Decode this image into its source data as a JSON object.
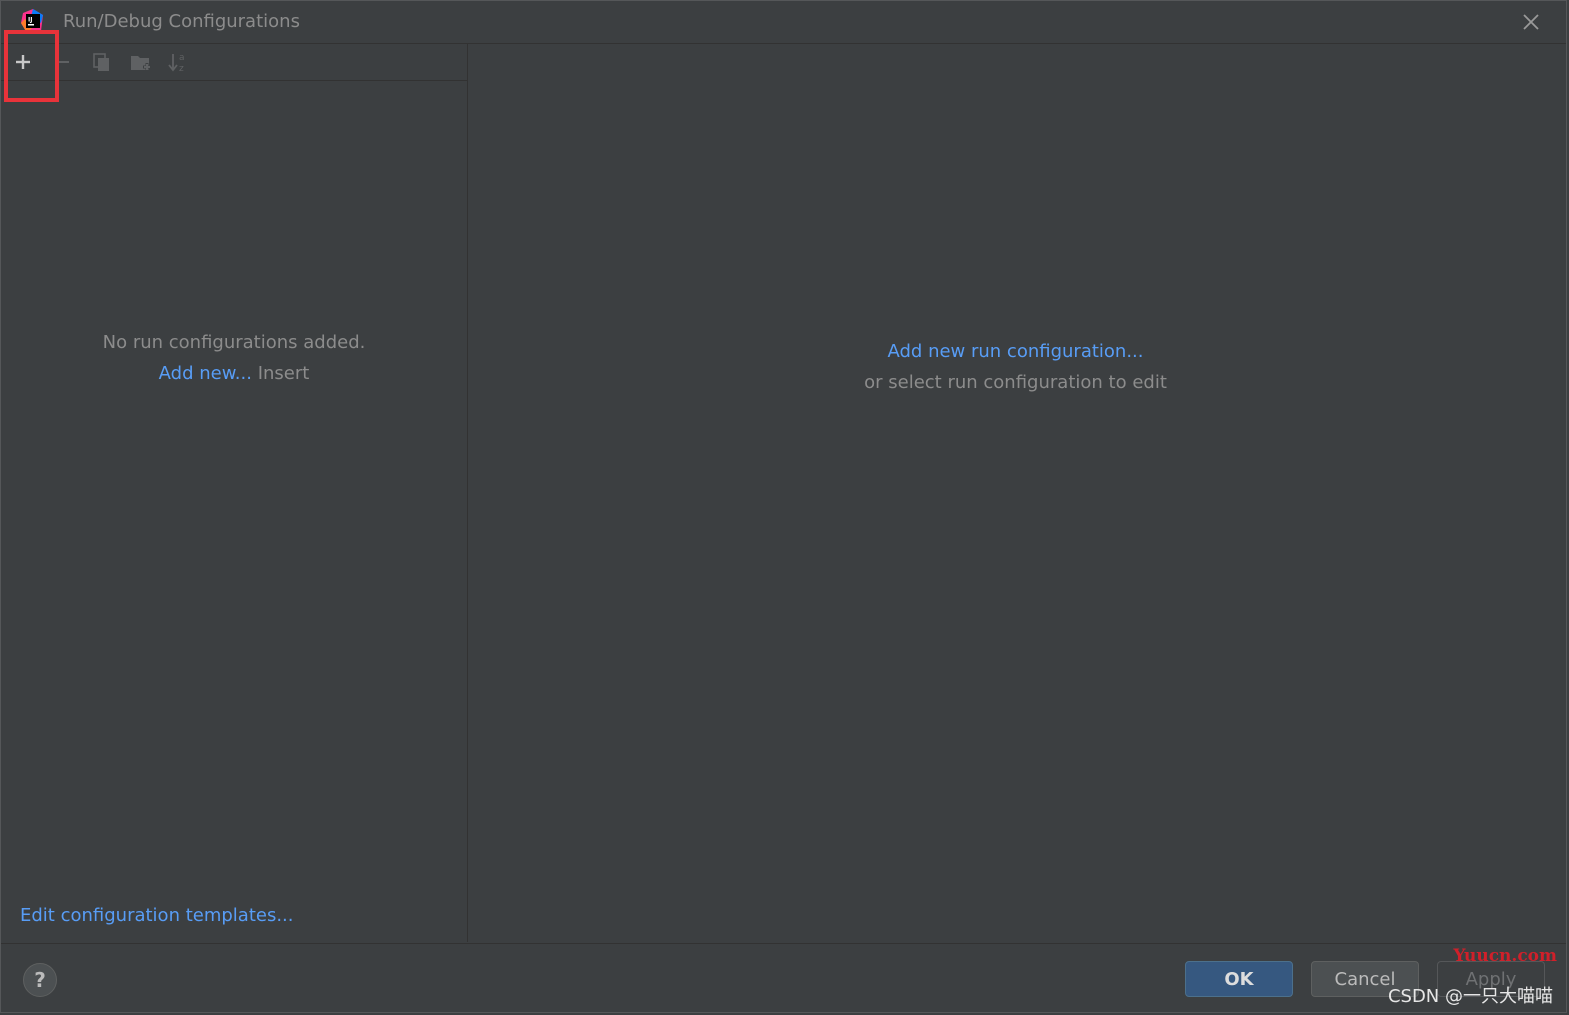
{
  "window": {
    "title": "Run/Debug Configurations"
  },
  "toolbar": {
    "add_icon": "plus-icon",
    "remove_icon": "minus-icon",
    "copy_icon": "copy-icon",
    "folder_icon": "new-folder-icon",
    "sort_icon": "sort-alphabetical-icon"
  },
  "left_pane": {
    "empty_message": "No run configurations added.",
    "add_new_link": "Add new...",
    "add_new_shortcut": "Insert",
    "templates_link": "Edit configuration templates..."
  },
  "right_pane": {
    "add_link": "Add new run configuration...",
    "hint": "or select run configuration to edit"
  },
  "buttons": {
    "help": "?",
    "ok": "OK",
    "cancel": "Cancel",
    "apply": "Apply"
  },
  "watermarks": {
    "site": "Yuucn.com",
    "author": "CSDN @一只大喵喵"
  },
  "colors": {
    "background": "#3c3f41",
    "link": "#589df6",
    "muted_text": "#8c8c8c",
    "highlight_box": "#e8333a",
    "ok_button": "#365880"
  }
}
